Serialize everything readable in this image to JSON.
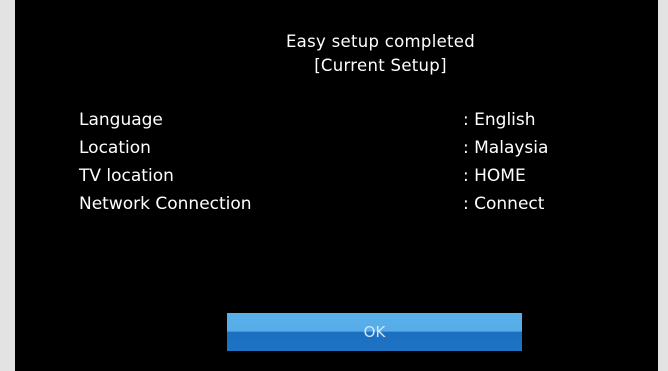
{
  "dialog": {
    "title": "Easy setup completed",
    "subtitle": "[Current Setup]"
  },
  "settings": [
    {
      "label": "Language",
      "value": ": English"
    },
    {
      "label": "Location",
      "value": ": Malaysia"
    },
    {
      "label": "TV location",
      "value": ": HOME"
    },
    {
      "label": "Network Connection",
      "value": ": Connect"
    }
  ],
  "ok_button": {
    "label": "OK"
  },
  "colors": {
    "screen_background": "#000000",
    "frame_background": "#e3e3e3",
    "button_blue": "#3a8fd8",
    "text": "#ffffff"
  }
}
